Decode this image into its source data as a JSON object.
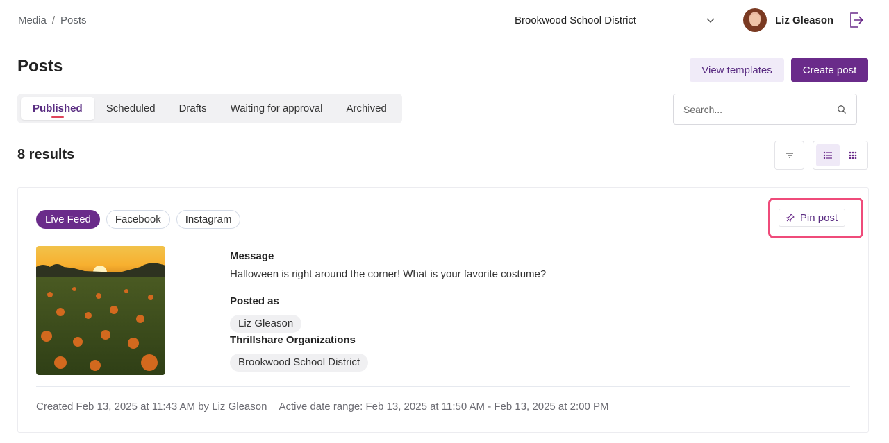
{
  "breadcrumb": {
    "items": [
      "Media",
      "Posts"
    ],
    "separator": "/"
  },
  "org_select": {
    "value": "Brookwood School District",
    "icon": "chevron-down-icon"
  },
  "user": {
    "name": "Liz Gleason",
    "logout_icon": "logout-icon"
  },
  "page": {
    "title": "Posts"
  },
  "actions": {
    "view_templates": "View templates",
    "create_post": "Create post"
  },
  "tabs": [
    {
      "label": "Published",
      "active": true
    },
    {
      "label": "Scheduled",
      "active": false
    },
    {
      "label": "Drafts",
      "active": false
    },
    {
      "label": "Waiting for approval",
      "active": false
    },
    {
      "label": "Archived",
      "active": false
    }
  ],
  "search": {
    "placeholder": "Search...",
    "value": ""
  },
  "results": {
    "label": "8 results"
  },
  "view": {
    "mode": "list"
  },
  "post": {
    "channels": [
      "Live Feed",
      "Facebook",
      "Instagram"
    ],
    "pin_label": "Pin post",
    "message_label": "Message",
    "message": "Halloween is right around the corner! What is your favorite costume?",
    "posted_as_label": "Posted as",
    "posted_as": "Liz Gleason",
    "orgs_label": "Thrillshare Organizations",
    "org": "Brookwood School District",
    "created": "Created Feb 13, 2025 at 11:43 AM by Liz Gleason",
    "active_range": "Active date range: Feb 13, 2025 at 11:50 AM - Feb 13, 2025 at 2:00 PM"
  },
  "colors": {
    "brand": "#6a2b8a",
    "highlight": "#ef4b7a",
    "tab_underline": "#e0465a"
  }
}
